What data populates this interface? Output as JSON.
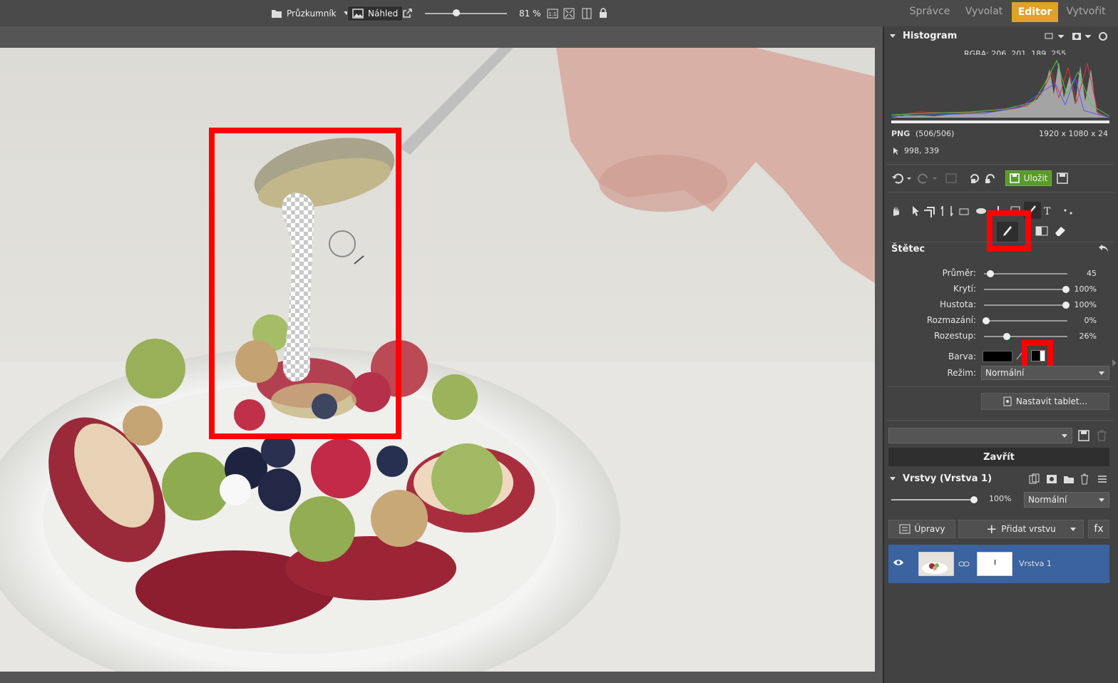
{
  "topbar": {
    "browser_label": "Průzkumník",
    "preview_label": "Náhled",
    "zoom": "81 %",
    "zoom_value_fraction": 0.38,
    "tabs": [
      {
        "label": "Správce",
        "active": false
      },
      {
        "label": "Vyvolat",
        "active": false
      },
      {
        "label": "Editor",
        "active": true
      },
      {
        "label": "Vytvořit",
        "active": false
      }
    ]
  },
  "histogram": {
    "title": "Histogram",
    "rgba": "RGBA: 206, 201, 189, 255",
    "format": "PNG",
    "index": "(506/506)",
    "dimensions": "1920 x 1080 x 24",
    "cursor_pos": "998, 339"
  },
  "toolbar": {
    "save_label": "Uložit"
  },
  "brush": {
    "title": "Štětec",
    "rows": [
      {
        "label": "Průměr:",
        "value": "45",
        "fraction": 0.05
      },
      {
        "label": "Krytí:",
        "value": "100%",
        "fraction": 1.0
      },
      {
        "label": "Hustota:",
        "value": "100%",
        "fraction": 1.0
      },
      {
        "label": "Rozmazání:",
        "value": "0%",
        "fraction": 0.0
      },
      {
        "label": "Rozestup:",
        "value": "26%",
        "fraction": 0.26
      }
    ],
    "color_label": "Barva:",
    "color_value": "#000000",
    "mode_label": "Režim:",
    "mode_value": "Normální",
    "tablet_button": "Nastavit tablet...",
    "close_button": "Zavřít"
  },
  "layers": {
    "title": "Vrstvy (Vrstva 1)",
    "opacity": "100%",
    "opacity_fraction": 1.0,
    "blend_mode": "Normální",
    "adjust_button": "Úpravy",
    "add_layer_button": "Přidat vrstvu",
    "fx_button": "fx",
    "items": [
      {
        "name": "Vrstva 1"
      }
    ]
  },
  "colors": {
    "accent": "#e0a12a",
    "save_green": "#5a9a2a",
    "selected_layer": "#3a63a0",
    "highlight_red": "#ff0000"
  }
}
